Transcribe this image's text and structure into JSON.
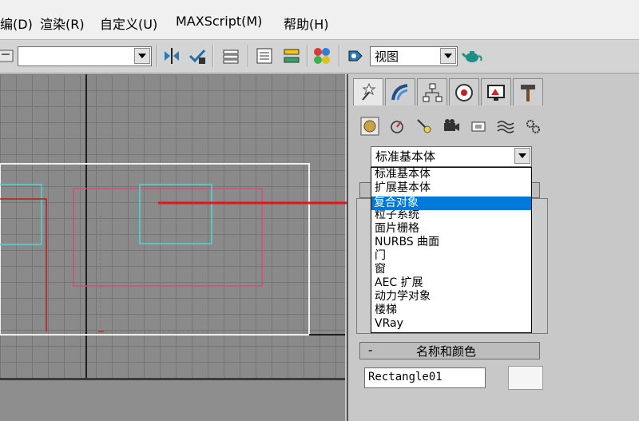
{
  "menubar": {
    "items": [
      "编(D)",
      "渲染(R)",
      "自定义(U)",
      "MAXScript(M)",
      "帮助(H)"
    ]
  },
  "toolbar": {
    "selection_set_value": "",
    "view_combo_value": "视图"
  },
  "command_panel": {
    "category_value": "标准基本体",
    "dropdown_options": [
      "标准基本体",
      "扩展基本体",
      "复合对象",
      "粒子系统",
      "面片栅格",
      "NURBS 曲面",
      "门",
      "窗",
      "AEC 扩展",
      "动力学对象",
      "楼梯",
      "VRay"
    ],
    "selected_option": "复合对象",
    "rollout_title": "名称和颜色",
    "rollout_toggle": "-",
    "object_name": "Rectangle01"
  },
  "colors": {
    "highlight": "#0078d7",
    "arrow": "#e8141b",
    "shape_cyan": "#4fd6d0",
    "shape_pink": "#d0507a",
    "axis_red": "#b02020"
  }
}
